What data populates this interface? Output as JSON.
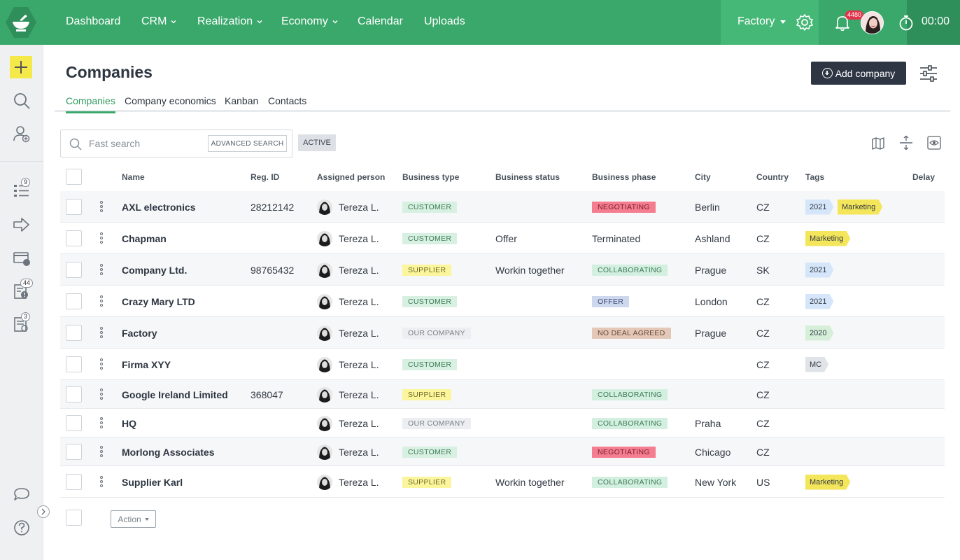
{
  "nav": {
    "items": [
      {
        "label": "Dashboard",
        "dropdown": false
      },
      {
        "label": "CRM",
        "dropdown": true
      },
      {
        "label": "Realization",
        "dropdown": true
      },
      {
        "label": "Economy",
        "dropdown": true
      },
      {
        "label": "Calendar",
        "dropdown": false
      },
      {
        "label": "Uploads",
        "dropdown": false
      }
    ],
    "company_switch": "Factory",
    "notifications_count": "4480",
    "timer": "00:00"
  },
  "sidebar": {
    "badges": {
      "tasks": "9",
      "alerts": "44",
      "notes": "3"
    }
  },
  "page": {
    "title": "Companies",
    "add_button": "Add company",
    "tabs": [
      "Companies",
      "Company economics",
      "Kanban",
      "Contacts"
    ],
    "active_tab": "Companies"
  },
  "search": {
    "placeholder": "Fast search",
    "advanced": "ADVANCED SEARCH",
    "filter_chip": "ACTIVE"
  },
  "table": {
    "columns": [
      "Name",
      "Reg. ID",
      "Assigned person",
      "Business type",
      "Business status",
      "Business phase",
      "City",
      "Country",
      "Tags",
      "Delay"
    ],
    "rows": [
      {
        "name": "AXL electronics",
        "reg_id": "28212142",
        "person": "Tereza L.",
        "type": "CUSTOMER",
        "status": "",
        "phase": "NEGOTIATING",
        "phase_style": "pill",
        "city": "Berlin",
        "country": "CZ",
        "tags": [
          "2021",
          "Marketing"
        ]
      },
      {
        "name": "Chapman",
        "reg_id": "",
        "person": "Tereza L.",
        "type": "CUSTOMER",
        "status": "Offer",
        "phase": "Terminated",
        "phase_style": "text",
        "city": "Ashland",
        "country": "CZ",
        "tags": [
          "Marketing"
        ]
      },
      {
        "name": "Company Ltd.",
        "reg_id": "98765432",
        "person": "Tereza L.",
        "type": "SUPPLIER",
        "status": "Workin together",
        "phase": "COLLABORATING",
        "phase_style": "pill",
        "city": "Prague",
        "country": "SK",
        "tags": [
          "2021"
        ]
      },
      {
        "name": "Crazy Mary LTD",
        "reg_id": "",
        "person": "Tereza L.",
        "type": "CUSTOMER",
        "status": "",
        "phase": "OFFER",
        "phase_style": "pill",
        "city": "London",
        "country": "CZ",
        "tags": [
          "2021"
        ]
      },
      {
        "name": "Factory",
        "reg_id": "",
        "person": "Tereza L.",
        "type": "OUR COMPANY",
        "status": "",
        "phase": "NO DEAL AGREED",
        "phase_style": "pill",
        "city": "Prague",
        "country": "CZ",
        "tags": [
          "2020"
        ]
      },
      {
        "name": "Firma XYY",
        "reg_id": "",
        "person": "Tereza L.",
        "type": "CUSTOMER",
        "status": "",
        "phase": "",
        "phase_style": "none",
        "city": "",
        "country": "CZ",
        "tags": [
          "MC"
        ]
      },
      {
        "name": "Google Ireland Limited",
        "reg_id": "368047",
        "person": "Tereza L.",
        "type": "SUPPLIER",
        "status": "",
        "phase": "COLLABORATING",
        "phase_style": "pill",
        "city": "",
        "country": "CZ",
        "tags": []
      },
      {
        "name": "HQ",
        "reg_id": "",
        "person": "Tereza L.",
        "type": "OUR COMPANY",
        "status": "",
        "phase": "COLLABORATING",
        "phase_style": "pill",
        "city": "Praha",
        "country": "CZ",
        "tags": []
      },
      {
        "name": "Morlong Associates",
        "reg_id": "",
        "person": "Tereza L.",
        "type": "CUSTOMER",
        "status": "",
        "phase": "NEGOTIATING",
        "phase_style": "pill",
        "city": "Chicago",
        "country": "CZ",
        "tags": []
      },
      {
        "name": "Supplier Karl",
        "reg_id": "",
        "person": "Tereza L.",
        "type": "SUPPLIER",
        "status": "Workin together",
        "phase": "COLLABORATING",
        "phase_style": "pill",
        "city": "New York",
        "country": "US",
        "tags": [
          "Marketing"
        ]
      }
    ]
  },
  "footer": {
    "action_label": "Action"
  },
  "colors": {
    "brand_green": "#3aa86b",
    "dark_button": "#2e3644",
    "type_customer_bg": "#d7f0e1",
    "type_customer_fg": "#3d7a56",
    "type_supplier_bg": "#fbf59b",
    "type_supplier_fg": "#6d6a2a",
    "type_our_bg": "#eceef1",
    "type_our_fg": "#7a828a",
    "phase_negotiating_bg": "#f47d8f",
    "phase_negotiating_fg": "#7a1f2c",
    "phase_collaborating_bg": "#d3efe0",
    "phase_collaborating_fg": "#3d7a56",
    "phase_offer_bg": "#cdd7ee",
    "phase_offer_fg": "#3c4b74",
    "phase_nodeal_bg": "#e3c7b7",
    "phase_nodeal_fg": "#6b4a36",
    "tag_year_bg": "#d6e6fa",
    "tag_2020_bg": "#d5efd9",
    "tag_marketing_bg": "#f4e65a",
    "tag_mc_bg": "#e0e3e8"
  }
}
